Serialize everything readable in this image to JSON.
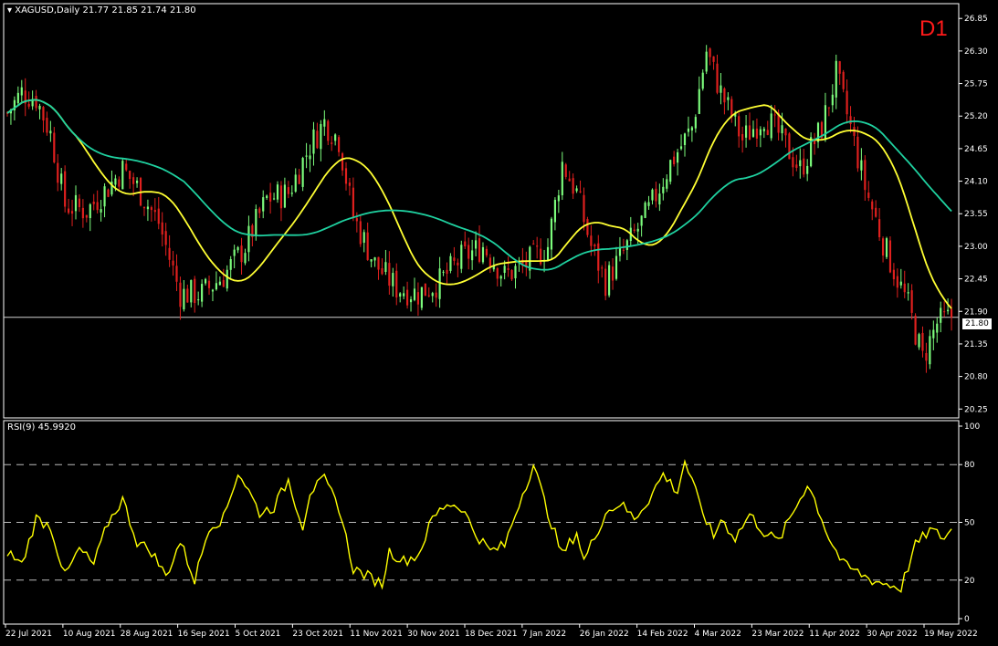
{
  "header": {
    "dropdown_icon": "triangle-down-icon",
    "symbol": "XAGUSD,Daily",
    "ohlc": "21.77 21.85 21.74 21.80",
    "timeframe": "D1"
  },
  "rsi_header": "RSI(9) 45.9920",
  "current_price_label": "21.80",
  "colors": {
    "background": "#000000",
    "bull_candle": "#7CFC7C",
    "bear_candle": "#E0201E",
    "ma_fast": "#FFFF33",
    "ma_slow": "#1FD1A0",
    "rsi_line": "#FFFF00",
    "timeframe_label": "#FF1A1A"
  },
  "chart_data": [
    {
      "type": "candlestick",
      "symbol": "XAGUSD",
      "ylim": [
        20.1,
        27.1
      ],
      "y_ticks": [
        "26.85",
        "26.30",
        "25.75",
        "25.20",
        "24.65",
        "24.10",
        "23.55",
        "23.00",
        "22.45",
        "21.90",
        "21.35",
        "20.80",
        "20.25"
      ],
      "x_ticks": [
        "22 Jul 2021",
        "10 Aug 2021",
        "28 Aug 2021",
        "16 Sep 2021",
        "5 Oct 2021",
        "23 Oct 2021",
        "11 Nov 2021",
        "30 Nov 2021",
        "18 Dec 2021",
        "7 Jan 2022",
        "26 Jan 2022",
        "14 Feb 2022",
        "4 Mar 2022",
        "23 Mar 2022",
        "11 Apr 2022",
        "30 Apr 2022",
        "19 May 2022"
      ],
      "close_anchors": [
        [
          0,
          25.25
        ],
        [
          4,
          25.6
        ],
        [
          8,
          25.5
        ],
        [
          12,
          24.9
        ],
        [
          16,
          23.7
        ],
        [
          22,
          23.6
        ],
        [
          28,
          24.0
        ],
        [
          32,
          24.3
        ],
        [
          36,
          24.0
        ],
        [
          42,
          23.4
        ],
        [
          48,
          22.2
        ],
        [
          54,
          22.2
        ],
        [
          60,
          22.5
        ],
        [
          66,
          23.0
        ],
        [
          72,
          23.8
        ],
        [
          78,
          23.9
        ],
        [
          84,
          24.7
        ],
        [
          88,
          25.1
        ],
        [
          92,
          24.8
        ],
        [
          96,
          23.5
        ],
        [
          102,
          22.7
        ],
        [
          108,
          22.3
        ],
        [
          114,
          22.2
        ],
        [
          120,
          22.4
        ],
        [
          126,
          22.8
        ],
        [
          132,
          23.0
        ],
        [
          138,
          22.5
        ],
        [
          144,
          22.7
        ],
        [
          150,
          23.0
        ],
        [
          154,
          24.4
        ],
        [
          158,
          23.9
        ],
        [
          162,
          23.0
        ],
        [
          166,
          22.4
        ],
        [
          172,
          23.0
        ],
        [
          178,
          23.6
        ],
        [
          184,
          24.4
        ],
        [
          190,
          25.0
        ],
        [
          194,
          26.3
        ],
        [
          198,
          25.6
        ],
        [
          204,
          24.8
        ],
        [
          210,
          25.2
        ],
        [
          214,
          24.9
        ],
        [
          220,
          24.3
        ],
        [
          226,
          25.0
        ],
        [
          230,
          25.9
        ],
        [
          234,
          25.0
        ],
        [
          238,
          24.0
        ],
        [
          244,
          22.9
        ],
        [
          250,
          22.0
        ],
        [
          254,
          21.1
        ],
        [
          258,
          21.7
        ],
        [
          262,
          21.8
        ]
      ],
      "moving_averages": [
        {
          "period": 20,
          "color": "#FFFF33"
        },
        {
          "period": 50,
          "color": "#1FD1A0"
        }
      ],
      "current_price": 21.8
    },
    {
      "type": "line",
      "name": "RSI(9)",
      "ylim": [
        0,
        100
      ],
      "y_ticks": [
        "100",
        "80",
        "50",
        "20",
        "0"
      ],
      "levels": [
        80,
        50,
        20
      ],
      "anchors": [
        [
          0,
          35
        ],
        [
          4,
          28
        ],
        [
          8,
          52
        ],
        [
          12,
          48
        ],
        [
          16,
          22
        ],
        [
          20,
          36
        ],
        [
          24,
          28
        ],
        [
          28,
          50
        ],
        [
          32,
          62
        ],
        [
          36,
          40
        ],
        [
          40,
          35
        ],
        [
          44,
          22
        ],
        [
          48,
          40
        ],
        [
          52,
          20
        ],
        [
          56,
          48
        ],
        [
          60,
          52
        ],
        [
          64,
          76
        ],
        [
          66,
          70
        ],
        [
          70,
          55
        ],
        [
          74,
          58
        ],
        [
          78,
          72
        ],
        [
          82,
          48
        ],
        [
          84,
          66
        ],
        [
          88,
          72
        ],
        [
          92,
          58
        ],
        [
          96,
          26
        ],
        [
          100,
          22
        ],
        [
          104,
          18
        ],
        [
          106,
          35
        ],
        [
          110,
          30
        ],
        [
          114,
          33
        ],
        [
          118,
          52
        ],
        [
          122,
          60
        ],
        [
          126,
          58
        ],
        [
          130,
          44
        ],
        [
          134,
          35
        ],
        [
          138,
          38
        ],
        [
          142,
          60
        ],
        [
          146,
          80
        ],
        [
          150,
          55
        ],
        [
          154,
          33
        ],
        [
          158,
          45
        ],
        [
          160,
          30
        ],
        [
          166,
          55
        ],
        [
          170,
          60
        ],
        [
          174,
          52
        ],
        [
          178,
          62
        ],
        [
          182,
          75
        ],
        [
          186,
          66
        ],
        [
          188,
          82
        ],
        [
          192,
          60
        ],
        [
          196,
          42
        ],
        [
          198,
          52
        ],
        [
          202,
          42
        ],
        [
          206,
          54
        ],
        [
          210,
          45
        ],
        [
          214,
          40
        ],
        [
          218,
          55
        ],
        [
          222,
          70
        ],
        [
          224,
          62
        ],
        [
          228,
          42
        ],
        [
          232,
          28
        ],
        [
          236,
          24
        ],
        [
          240,
          20
        ],
        [
          244,
          18
        ],
        [
          248,
          16
        ],
        [
          252,
          38
        ],
        [
          256,
          46
        ],
        [
          260,
          42
        ],
        [
          262,
          46
        ]
      ],
      "last_value": 45.992
    }
  ]
}
